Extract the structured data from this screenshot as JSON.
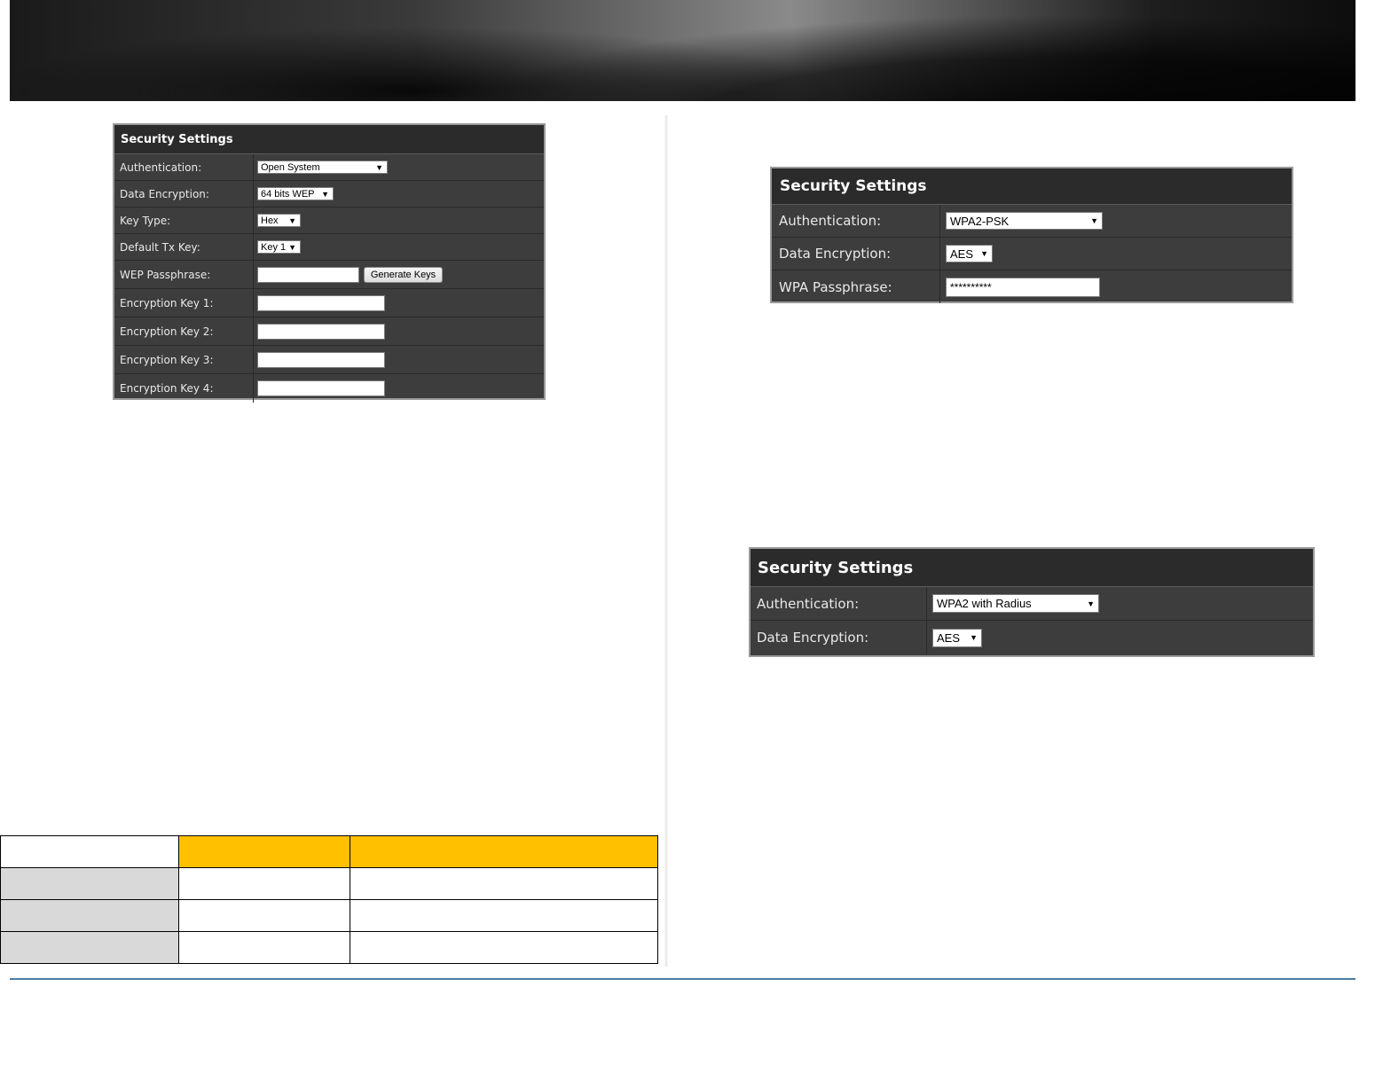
{
  "panel_wep": {
    "title": "Security Settings",
    "rows": [
      {
        "label": "Authentication:",
        "value": "Open System"
      },
      {
        "label": "Data Encryption:",
        "value": "64 bits WEP"
      },
      {
        "label": "Key Type:",
        "value": "Hex"
      },
      {
        "label": "Default Tx Key:",
        "value": "Key 1"
      },
      {
        "label": "WEP Passphrase:",
        "value": "",
        "button": "Generate Keys"
      },
      {
        "label": "Encryption Key 1:",
        "value": ""
      },
      {
        "label": "Encryption Key 2:",
        "value": ""
      },
      {
        "label": "Encryption Key 3:",
        "value": ""
      },
      {
        "label": "Encryption Key 4:",
        "value": ""
      }
    ]
  },
  "panel_psk": {
    "title": "Security Settings",
    "rows": [
      {
        "label": "Authentication:",
        "value": "WPA2-PSK"
      },
      {
        "label": "Data Encryption:",
        "value": "AES"
      },
      {
        "label": "WPA Passphrase:",
        "value": "**********"
      }
    ]
  },
  "panel_radius": {
    "title": "Security Settings",
    "rows": [
      {
        "label": "Authentication:",
        "value": "WPA2 with Radius"
      },
      {
        "label": "Data Encryption:",
        "value": "AES"
      }
    ]
  },
  "colors": {
    "table_header": "#ffc000",
    "table_label_cells": "#d9d9d9",
    "footer_rule": "#4a7ea4",
    "panel_bg": "#3d3d3d"
  },
  "icons": {
    "select_arrow": "chevron-down-icon"
  }
}
